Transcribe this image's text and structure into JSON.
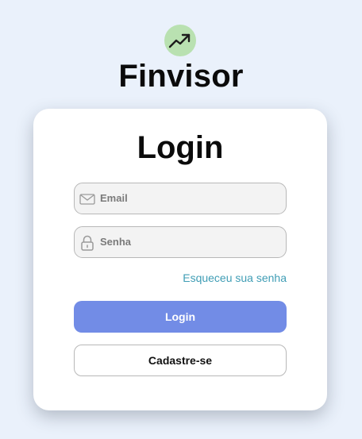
{
  "brand": {
    "name": "Finvisor",
    "logo_icon": "trending-up-icon",
    "logo_bg": "#b9e1b1"
  },
  "login_card": {
    "title": "Login",
    "email": {
      "placeholder": "Email",
      "value": "",
      "icon": "mail-icon"
    },
    "password": {
      "placeholder": "Senha",
      "value": "",
      "icon": "lock-icon"
    },
    "forgot_link": "Esqueceu sua senha",
    "login_button": "Login",
    "register_button": "Cadastre-se"
  },
  "colors": {
    "background": "#eaf1fb",
    "primary_button": "#728ce6",
    "link": "#3f9db5"
  }
}
